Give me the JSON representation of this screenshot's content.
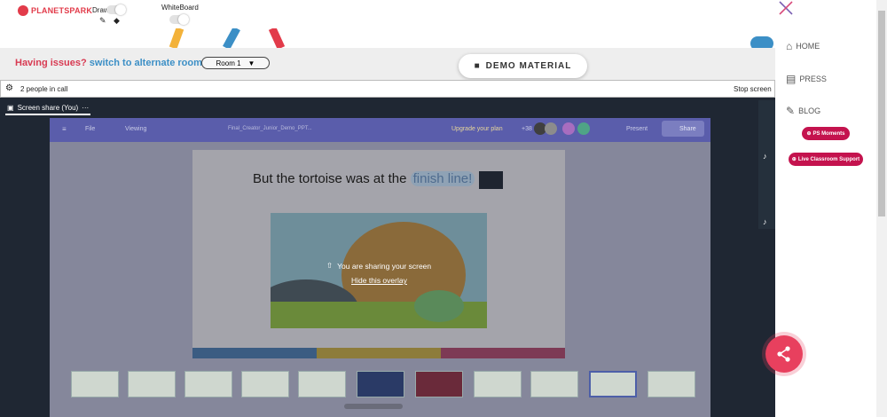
{
  "header": {
    "logo_text": "PLANETSPARK",
    "draw_label": "Draw",
    "whiteboard_label": "WhiteBoard"
  },
  "issue_bar": {
    "question": "Having issues?",
    "switch_link": "switch to alternate room",
    "room_value": "Room 1",
    "demo_button": "DEMO MATERIAL"
  },
  "call_bar": {
    "people": "2 people in call",
    "stop_label": "Stop screen"
  },
  "screen_share": {
    "label": "Screen share (You)",
    "menu": "···",
    "file_name": "Final_Creator_Junior_Demo_PPT...",
    "toolbar": {
      "file": "File",
      "viewing": "Viewing",
      "upgrade": "Upgrade your plan",
      "count": "+38",
      "present": "Present",
      "share": "Share"
    },
    "slide_title_a": "But the tortoise was at the",
    "slide_title_b": "finish line!",
    "overlay_message": "You are sharing your screen",
    "hide_overlay": "Hide this overlay"
  },
  "nav": {
    "home": "HOME",
    "press": "PRESS",
    "blog": "BLOG",
    "ps_moments": "PS Moments",
    "live_support": "Live Classroom Support"
  },
  "colors": {
    "brand": "#e23b4a",
    "link": "#3c8fc6",
    "pill": "#c4134e",
    "fab": "#e8405e"
  }
}
